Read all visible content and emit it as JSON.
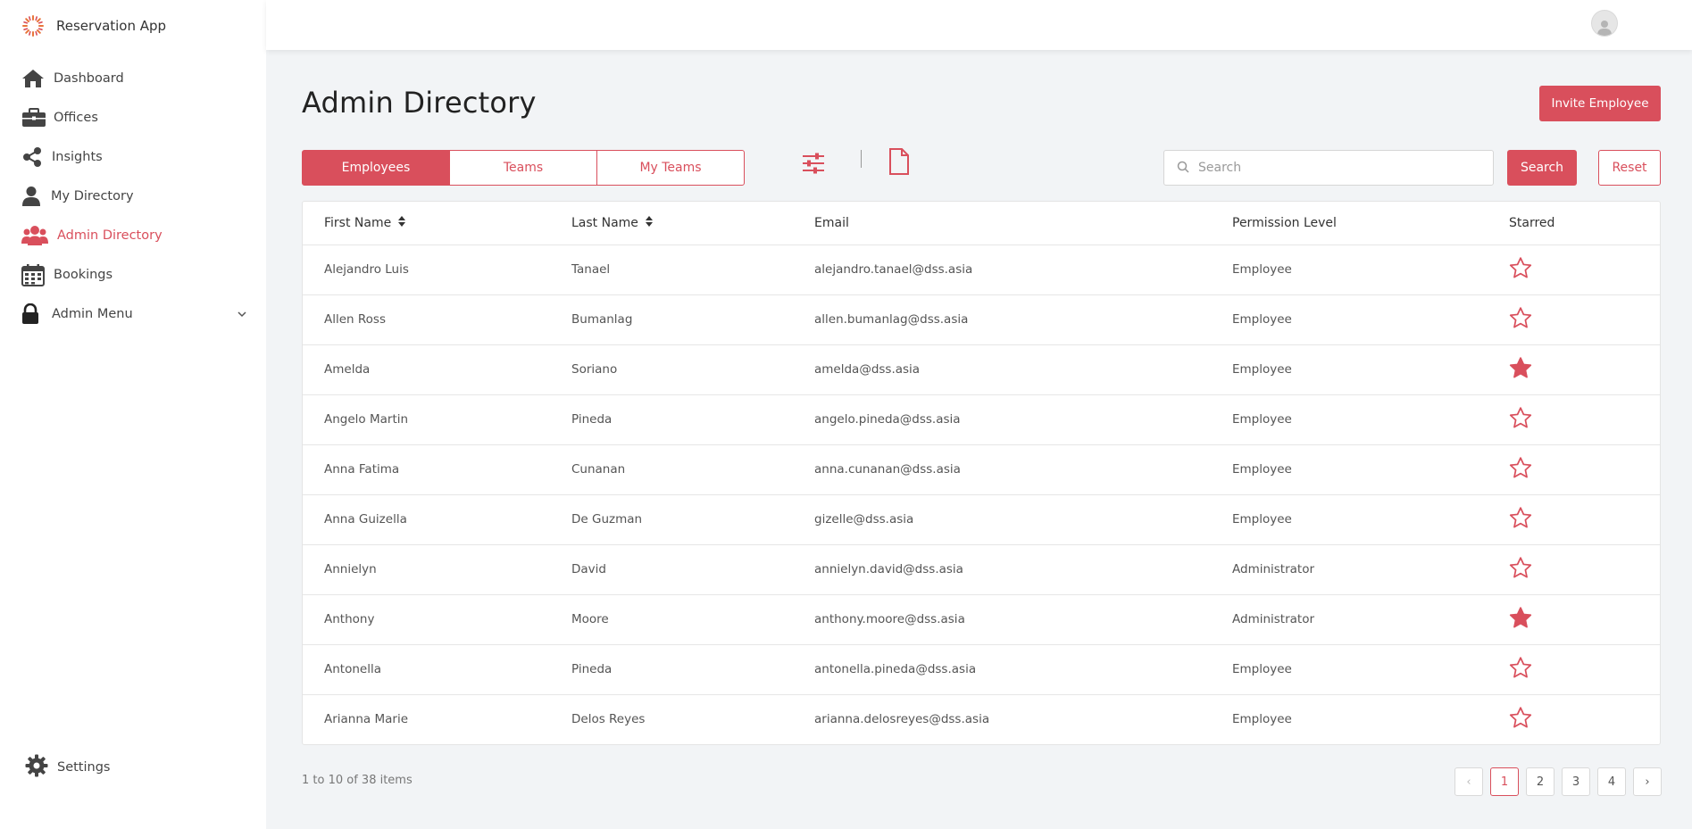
{
  "app": {
    "name": "Reservation App",
    "accent": "#d94f5c"
  },
  "sidebar": {
    "items": [
      {
        "label": "Dashboard",
        "icon": "home-icon"
      },
      {
        "label": "Offices",
        "icon": "briefcase-icon"
      },
      {
        "label": "Insights",
        "icon": "share-nodes-icon"
      },
      {
        "label": "My Directory",
        "icon": "user-icon"
      },
      {
        "label": "Admin Directory",
        "icon": "users-icon",
        "active": true
      },
      {
        "label": "Bookings",
        "icon": "calendar-icon"
      },
      {
        "label": "Admin Menu",
        "icon": "lock-icon",
        "expandable": true
      }
    ],
    "settings_label": "Settings"
  },
  "header": {
    "avatar_icon": "user-avatar-icon"
  },
  "main": {
    "title": "Admin Directory",
    "invite_label": "Invite Employee",
    "tabs": [
      {
        "label": "Employees",
        "active": true
      },
      {
        "label": "Teams"
      },
      {
        "label": "My Teams"
      }
    ],
    "search": {
      "placeholder": "Search",
      "value": "",
      "button_label": "Search",
      "reset_label": "Reset"
    }
  },
  "table": {
    "columns": [
      "First Name",
      "Last Name",
      "Email",
      "Permission Level",
      "Starred"
    ],
    "rows": [
      {
        "first": "Alejandro Luis",
        "last": "Tanael",
        "email": "alejandro.tanael@dss.asia",
        "level": "Employee",
        "starred": false
      },
      {
        "first": "Allen Ross",
        "last": "Bumanlag",
        "email": "allen.bumanlag@dss.asia",
        "level": "Employee",
        "starred": false
      },
      {
        "first": "Amelda",
        "last": "Soriano",
        "email": "amelda@dss.asia",
        "level": "Employee",
        "starred": true
      },
      {
        "first": "Angelo Martin",
        "last": "Pineda",
        "email": "angelo.pineda@dss.asia",
        "level": "Employee",
        "starred": false
      },
      {
        "first": "Anna Fatima",
        "last": "Cunanan",
        "email": "anna.cunanan@dss.asia",
        "level": "Employee",
        "starred": false
      },
      {
        "first": "Anna Guizella",
        "last": "De Guzman",
        "email": "gizelle@dss.asia",
        "level": "Employee",
        "starred": false
      },
      {
        "first": "Annielyn",
        "last": "David",
        "email": "annielyn.david@dss.asia",
        "level": "Administrator",
        "starred": false
      },
      {
        "first": "Anthony",
        "last": "Moore",
        "email": "anthony.moore@dss.asia",
        "level": "Administrator",
        "starred": true
      },
      {
        "first": "Antonella",
        "last": "Pineda",
        "email": "antonella.pineda@dss.asia",
        "level": "Employee",
        "starred": false
      },
      {
        "first": "Arianna Marie",
        "last": "Delos Reyes",
        "email": "arianna.delosreyes@dss.asia",
        "level": "Employee",
        "starred": false
      }
    ]
  },
  "pagination": {
    "summary": "1 to 10 of 38 items",
    "prev": "‹",
    "next": "›",
    "pages": [
      "1",
      "2",
      "3",
      "4"
    ],
    "current": "1"
  }
}
